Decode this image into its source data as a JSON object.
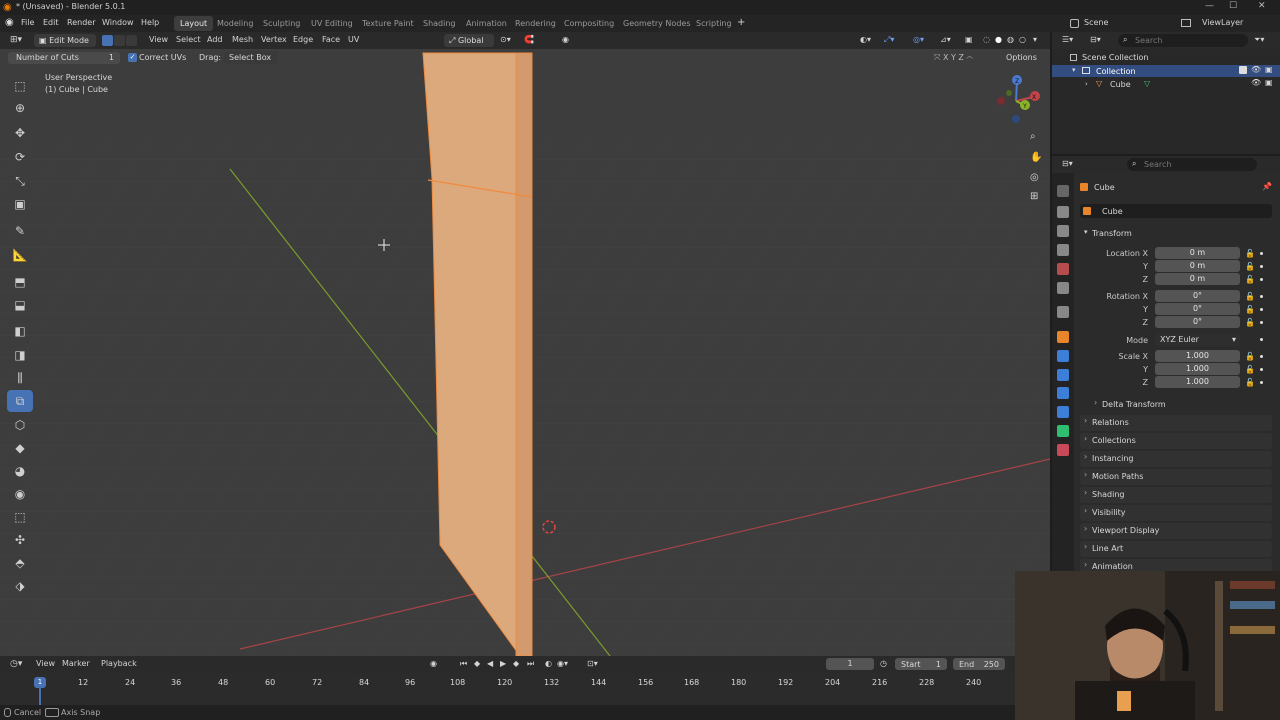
{
  "window": {
    "title": "* (Unsaved) - Blender 5.0.1",
    "controls": [
      "—",
      "☐",
      "✕"
    ]
  },
  "menus": [
    "File",
    "Edit",
    "Render",
    "Window",
    "Help"
  ],
  "workspaces": [
    "Layout",
    "Modeling",
    "Sculpting",
    "UV Editing",
    "Texture Paint",
    "Shading",
    "Animation",
    "Rendering",
    "Compositing",
    "Geometry Nodes",
    "Scripting"
  ],
  "active_workspace": "Layout",
  "add_workspace": "+",
  "scene": {
    "label": "Scene",
    "viewlayer": "ViewLayer"
  },
  "viewport_header": {
    "mode": "Edit Mode",
    "menus": [
      "View",
      "Select",
      "Add",
      "Mesh",
      "Vertex",
      "Edge",
      "Face",
      "UV"
    ],
    "orientation": "Global",
    "options": "Options"
  },
  "operator": {
    "cuts_label": "Number of Cuts",
    "cuts_value": "1",
    "correct_uvs": "Correct UVs",
    "drag_label": "Drag:",
    "drag_value": "Select Box"
  },
  "viewport_info": {
    "perspective": "User Perspective",
    "object": "(1) Cube | Cube"
  },
  "gizmo_axes": [
    "X",
    "Y",
    "Z"
  ],
  "timeline": {
    "menus": [
      "View",
      "Marker",
      "Playback"
    ],
    "current_frame": "1",
    "start_label": "Start",
    "start": "1",
    "end_label": "End",
    "end": "250",
    "ticks": [
      "1",
      "12",
      "24",
      "36",
      "48",
      "60",
      "72",
      "84",
      "96",
      "108",
      "120",
      "132",
      "144",
      "156",
      "168",
      "180",
      "192",
      "204",
      "216",
      "228",
      "240"
    ]
  },
  "statusbar": {
    "cancel": "Cancel",
    "snap": "Axis Snap"
  },
  "outliner": {
    "search_placeholder": "Search",
    "root": "Scene Collection",
    "collection": "Collection",
    "object": "Cube"
  },
  "properties": {
    "search_placeholder": "Search",
    "object_name": "Cube",
    "datablock_name": "Cube",
    "transform_title": "Transform",
    "location": {
      "label": "Location X",
      "x": "0 m",
      "y": "0 m",
      "z": "0 m"
    },
    "rotation": {
      "label": "Rotation X",
      "x": "0°",
      "y": "0°",
      "z": "0°"
    },
    "mode": {
      "label": "Mode",
      "value": "XYZ Euler"
    },
    "scale": {
      "label": "Scale X",
      "x": "1.000",
      "y": "1.000",
      "z": "1.000"
    },
    "axis_y": "Y",
    "axis_z": "Z",
    "delta_transform": "Delta Transform",
    "panels": [
      "Relations",
      "Collections",
      "Instancing",
      "Motion Paths",
      "Shading",
      "Visibility",
      "Viewport Display",
      "Line Art",
      "Animation"
    ]
  },
  "colors": {
    "accent": "#4772b3",
    "selection": "#f08a3c",
    "x_axis": "#c2454a",
    "y_axis": "#8ab428"
  }
}
